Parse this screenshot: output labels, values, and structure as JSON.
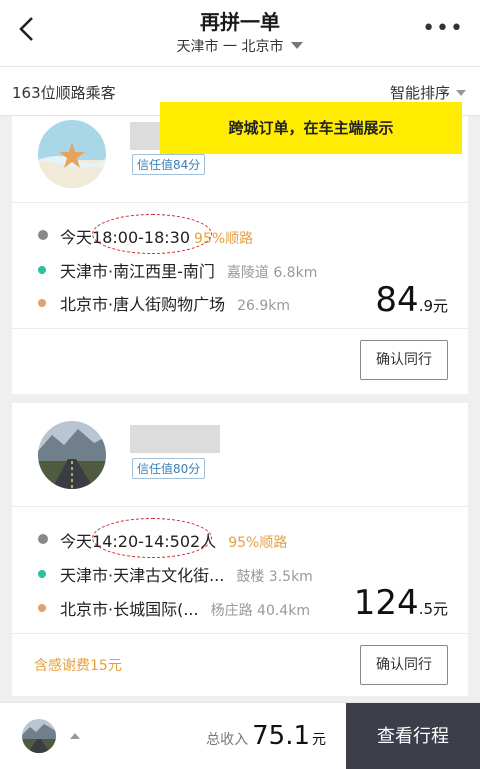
{
  "header": {
    "title": "再拼一单",
    "route": "天津市 一 北京市"
  },
  "subbar": {
    "count": "163位顺路乘客",
    "sort": "智能排序"
  },
  "banner": "跨城订单，在车主端展示",
  "orders": [
    {
      "trust": "信任值84分",
      "day": "今天",
      "time": "18:00-18:30",
      "seats": "",
      "match": "95%顺路",
      "from": "天津市·南江西里-南门",
      "from_hint": "嘉陵道 6.8km",
      "to": "北京市·唐人街购物广场",
      "to_hint": "26.9km",
      "price_int": "84",
      "price_dec": ".9元",
      "button": "确认同行",
      "thanks": ""
    },
    {
      "trust": "信任值80分",
      "day": "今天",
      "time": "14:20-14:50",
      "seats": "2人",
      "match": "95%顺路",
      "from": "天津市·天津古文化街...",
      "from_hint": "鼓楼 3.5km",
      "to": "北京市·长城国际(...",
      "to_hint": "杨庄路 40.4km",
      "price_int": "124",
      "price_dec": ".5元",
      "button": "确认同行",
      "thanks": "含感谢费15元"
    }
  ],
  "footer": {
    "income_label": "总收入",
    "income_value": "75.1",
    "income_unit": "元",
    "view_button": "查看行程"
  },
  "colors": {
    "banner": "#ffec00",
    "accent_orange": "#e4a040",
    "annotation_red": "#cc2a2a",
    "footer_button": "#3c3f4a"
  }
}
